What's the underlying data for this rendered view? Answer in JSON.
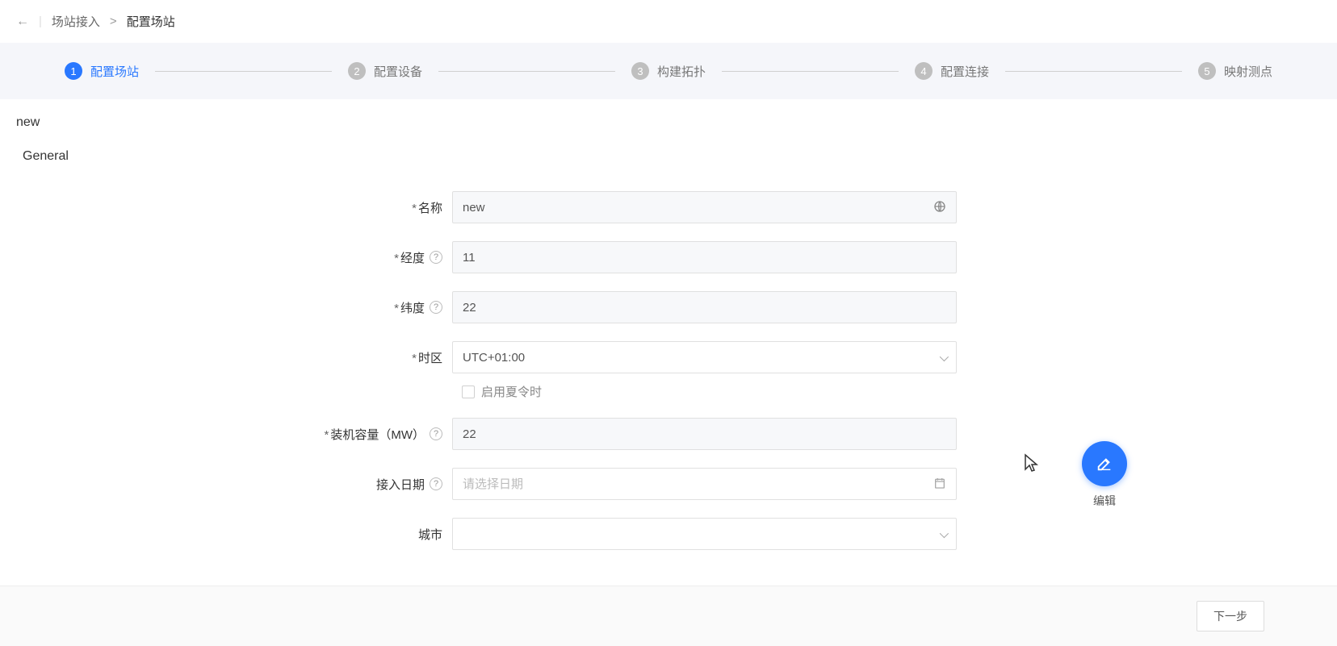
{
  "breadcrumb": {
    "back_icon": "←",
    "divider": "|",
    "parent": "场站接入",
    "sep": ">",
    "current": "配置场站"
  },
  "steps": [
    {
      "num": "1",
      "label": "配置场站",
      "active": true
    },
    {
      "num": "2",
      "label": "配置设备",
      "active": false
    },
    {
      "num": "3",
      "label": "构建拓扑",
      "active": false
    },
    {
      "num": "4",
      "label": "配置连接",
      "active": false
    },
    {
      "num": "5",
      "label": "映射测点",
      "active": false
    }
  ],
  "page": {
    "title": "new",
    "section": "General"
  },
  "form": {
    "name": {
      "label": "名称",
      "value": "new",
      "required": true
    },
    "longitude": {
      "label": "经度",
      "value": "11",
      "required": true
    },
    "latitude": {
      "label": "纬度",
      "value": "22",
      "required": true
    },
    "timezone": {
      "label": "时区",
      "value": "UTC+01:00",
      "required": true
    },
    "dst": {
      "label": "启用夏令时"
    },
    "capacity": {
      "label": "装机容量（MW）",
      "value": "22",
      "required": true
    },
    "access_date": {
      "label": "接入日期",
      "placeholder": "请选择日期",
      "value": ""
    },
    "city": {
      "label": "城市",
      "value": ""
    }
  },
  "fab": {
    "label": "编辑"
  },
  "footer": {
    "next": "下一步"
  }
}
